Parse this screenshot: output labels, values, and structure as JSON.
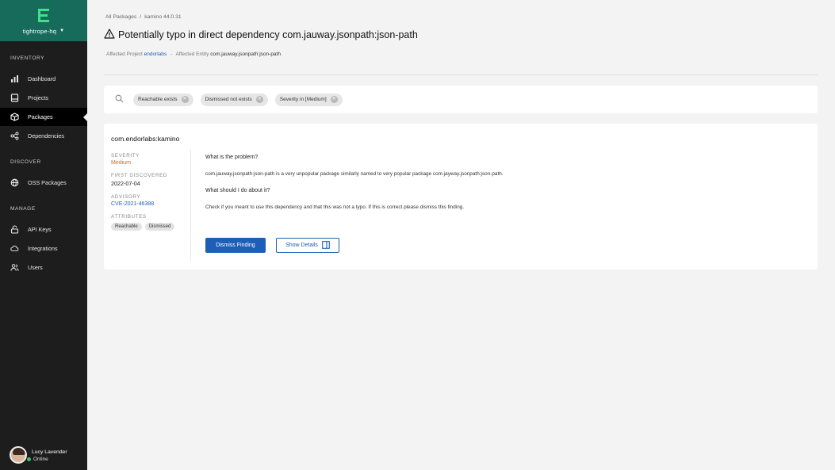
{
  "sidebar": {
    "org": "tightrope-hq",
    "sections": {
      "inventory": "INVENTORY",
      "discover": "DISCOVER",
      "manage": "MANAGE"
    },
    "items": [
      {
        "label": "Dashboard",
        "icon": "bar-chart-icon"
      },
      {
        "label": "Projects",
        "icon": "project-icon"
      },
      {
        "label": "Packages",
        "icon": "package-icon",
        "active": true
      },
      {
        "label": "Dependencies",
        "icon": "dependencies-icon"
      },
      {
        "label": "OSS Packages",
        "icon": "globe-icon"
      },
      {
        "label": "API Keys",
        "icon": "lock-icon"
      },
      {
        "label": "Integrations",
        "icon": "cloud-icon"
      },
      {
        "label": "Users",
        "icon": "users-icon"
      }
    ],
    "user": {
      "name": "Lucy Lavender",
      "status": "Online"
    }
  },
  "breadcrumb": {
    "root": "All Packages",
    "separator": "/",
    "current": "kamino 44.0.31"
  },
  "page": {
    "title": "Potentially typo in direct dependency com.jauway.jsonpath:json-path",
    "meta": {
      "project_label": "Affected Project",
      "project_value": "endorlabs",
      "separator": "-",
      "entity_label": "Affected Entity",
      "entity_value": "com.jauway.jsonpath:json-path"
    }
  },
  "filters": [
    "Reachable exists",
    "Dismissed not exists",
    "Severity in [Medium]"
  ],
  "finding": {
    "package": "com.endorlabs:kamino",
    "severity_label": "SEVERITY",
    "severity_value": "Medium",
    "first_discovered_label": "FIRST DISCOVERED",
    "first_discovered_value": "2022-07-04",
    "advisory_label": "ADVISORY",
    "advisory_value": "CVE-2021-46388",
    "attributes_label": "ATTRIBUTES",
    "attributes": [
      "Reachable",
      "Dismissed"
    ],
    "problem_q": "What is the problem?",
    "problem_a": "com.jauway.jsonpath:json-path is a very unpopular package similarly named to very popular package com.jayway.jsonpath:json-path.",
    "action_q": "What should I do about it?",
    "action_a": "Check if you meant to use this dependency and that this was not a typo. If this is correct please dismiss this finding.",
    "dismiss_button": "Dismiss Finding",
    "details_button": "Show Details"
  },
  "colors": {
    "brand": "#176b5a",
    "accent": "#1d5fb6",
    "severity_medium": "#d36b18"
  }
}
